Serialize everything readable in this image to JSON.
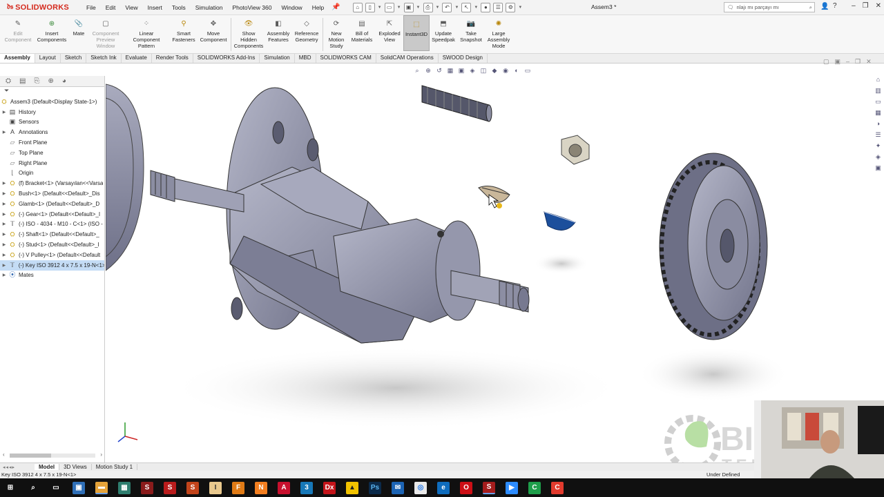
{
  "app": {
    "name": "SOLIDWORKS",
    "document_title": "Assem3 *",
    "menu": [
      "File",
      "Edit",
      "View",
      "Insert",
      "Tools",
      "Simulation",
      "PhotoView 360",
      "Window",
      "Help"
    ],
    "search_placeholder": "nlajı mı parçayı mı"
  },
  "ribbon": {
    "buttons": [
      {
        "label": "Edit Component",
        "disabled": true
      },
      {
        "label": "Insert Components",
        "disabled": false
      },
      {
        "label": "Mate",
        "disabled": false
      },
      {
        "label": "Component Preview Window",
        "disabled": true
      },
      {
        "label": "Linear Component Pattern",
        "disabled": false
      },
      {
        "label": "Smart Fasteners",
        "disabled": false
      },
      {
        "label": "Move Component",
        "disabled": false
      },
      {
        "label": "Show Hidden Components",
        "disabled": false
      },
      {
        "label": "Assembly Features",
        "disabled": false
      },
      {
        "label": "Reference Geometry",
        "disabled": false
      },
      {
        "label": "New Motion Study",
        "disabled": false
      },
      {
        "label": "Bill of Materials",
        "disabled": false
      },
      {
        "label": "Exploded View",
        "disabled": false
      },
      {
        "label": "Instant3D",
        "disabled": false,
        "active": true
      },
      {
        "label": "Update Speedpak",
        "disabled": false
      },
      {
        "label": "Take Snapshot",
        "disabled": false
      },
      {
        "label": "Large Assembly Mode",
        "disabled": false
      }
    ]
  },
  "tabs": [
    {
      "label": "Assembly",
      "active": true
    },
    {
      "label": "Layout"
    },
    {
      "label": "Sketch"
    },
    {
      "label": "Sketch Ink"
    },
    {
      "label": "Evaluate"
    },
    {
      "label": "Render Tools"
    },
    {
      "label": "SOLIDWORKS Add-Ins"
    },
    {
      "label": "Simulation"
    },
    {
      "label": "MBD"
    },
    {
      "label": "SOLIDWORKS CAM"
    },
    {
      "label": "SolidCAM Operations"
    },
    {
      "label": "SWOOD Design"
    }
  ],
  "tree": {
    "root": "Assem3  (Default<Display State-1>)",
    "items": [
      {
        "label": "History",
        "icon": "history-icon",
        "expand": true
      },
      {
        "label": "Sensors",
        "icon": "sensor-icon",
        "expand": false
      },
      {
        "label": "Annotations",
        "icon": "annotation-icon",
        "expand": true
      },
      {
        "label": "Front Plane",
        "icon": "plane-icon",
        "expand": false
      },
      {
        "label": "Top Plane",
        "icon": "plane-icon",
        "expand": false
      },
      {
        "label": "Right Plane",
        "icon": "plane-icon",
        "expand": false
      },
      {
        "label": "Origin",
        "icon": "origin-icon",
        "expand": false
      },
      {
        "label": "(f) Bracket<1> (Varsayılan<<Varsa",
        "icon": "part-icon",
        "expand": true
      },
      {
        "label": "Bush<1> (Default<<Default>_Dis",
        "icon": "part-icon",
        "expand": true
      },
      {
        "label": "Glamb<1> (Default<<Default>_D",
        "icon": "part-icon",
        "expand": true
      },
      {
        "label": "(-) Gear<1> (Default<<Default>_I",
        "icon": "part-icon",
        "expand": true
      },
      {
        "label": "(-) ISO - 4034 - M10 - C<1> (ISO -",
        "icon": "fastener-icon",
        "expand": true
      },
      {
        "label": "(-) Shaft<1> (Default<<Default>_",
        "icon": "part-icon",
        "expand": true
      },
      {
        "label": "(-) Stud<1> (Default<<Default>_I",
        "icon": "part-icon",
        "expand": true
      },
      {
        "label": "(-) V Pulley<1> (Default<<Default",
        "icon": "part-icon",
        "expand": true
      },
      {
        "label": "(-) Key ISO 3912 4 x 7.5 x 19-N<1>",
        "icon": "fastener-icon",
        "expand": true,
        "selected": true
      },
      {
        "label": "Mates",
        "icon": "mate-icon",
        "expand": true
      }
    ]
  },
  "bottom_tabs": [
    {
      "label": "Model",
      "active": true
    },
    {
      "label": "3D Views"
    },
    {
      "label": "Motion Study 1"
    }
  ],
  "status": {
    "left": "Key ISO 3912 4 x 7.5 x 19-N<1>",
    "right": "Under Defined"
  },
  "watermark": {
    "line1": "BIO",
    "line2": "TEKNO"
  },
  "colors": {
    "brand": "#d52b1e",
    "part_fill": "#8d8fa6",
    "key_blue": "#1c4f9c",
    "selection": "#c4dcf5"
  }
}
